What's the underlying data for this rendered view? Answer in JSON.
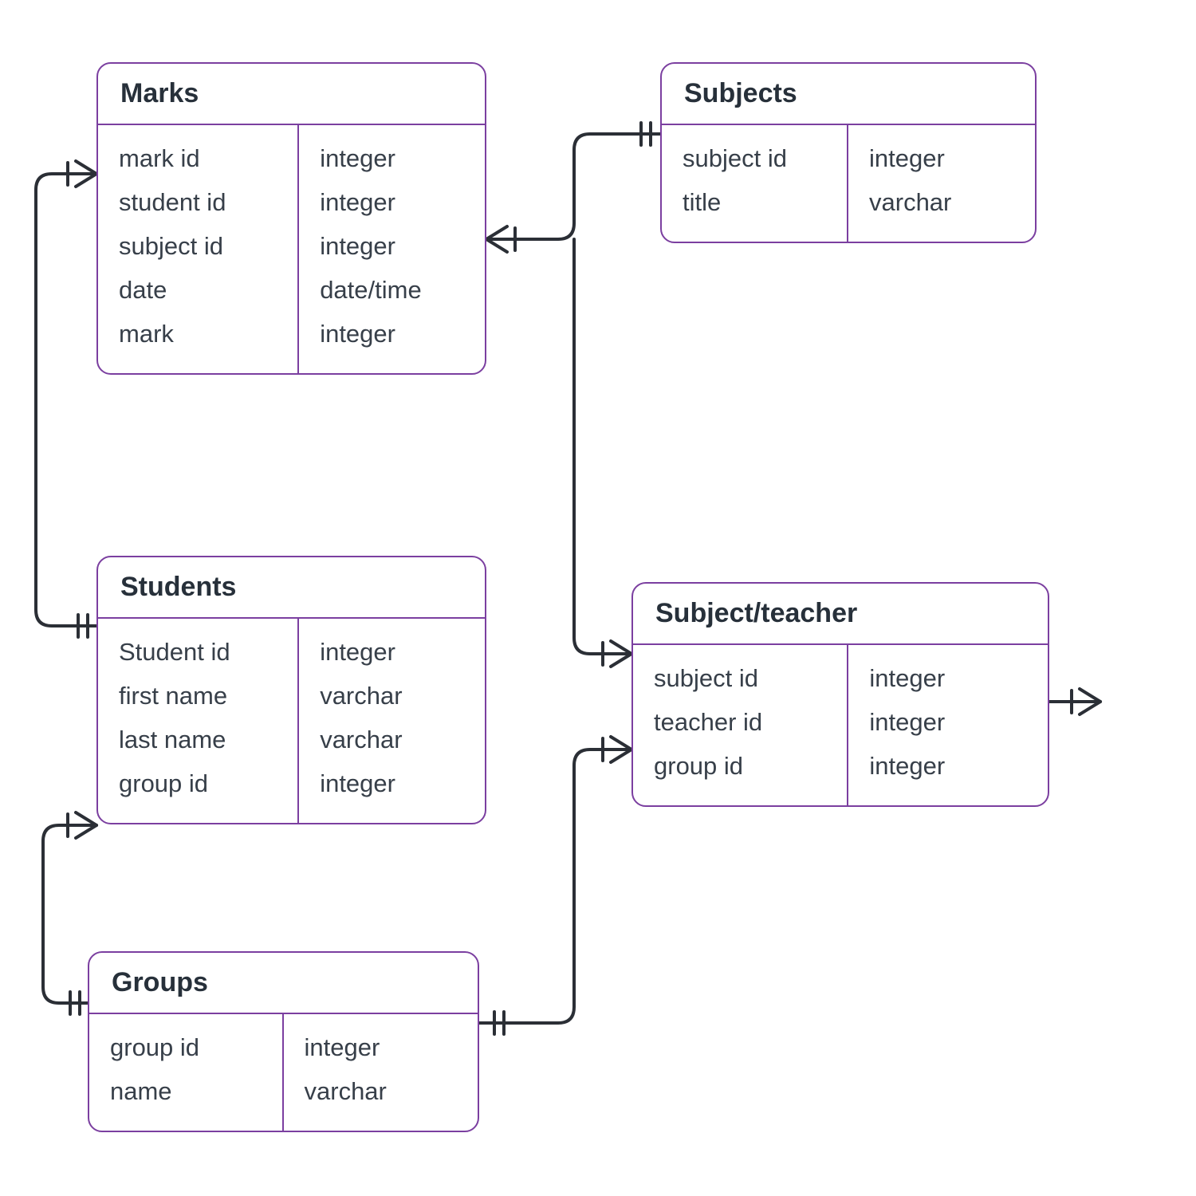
{
  "colors": {
    "border": "#7b3fa0",
    "text_title": "#27303a",
    "text_body": "#373f49",
    "wire": "#2b2f36"
  },
  "entities": {
    "marks": {
      "title": "Marks",
      "fields": [
        "mark id",
        "student id",
        "subject id",
        "date",
        "mark"
      ],
      "types": [
        "integer",
        "integer",
        "integer",
        "date/time",
        "integer"
      ]
    },
    "students": {
      "title": "Students",
      "fields": [
        "Student id",
        "first name",
        "last name",
        "group id"
      ],
      "types": [
        "integer",
        "varchar",
        "varchar",
        "integer"
      ]
    },
    "groups": {
      "title": "Groups",
      "fields": [
        "group id",
        "name"
      ],
      "types": [
        "integer",
        "varchar"
      ]
    },
    "subjects": {
      "title": "Subjects",
      "fields": [
        "subject id",
        "title"
      ],
      "types": [
        "integer",
        "varchar"
      ]
    },
    "subject_teacher": {
      "title": "Subject/teacher",
      "fields": [
        "subject id",
        "teacher id",
        "group id"
      ],
      "types": [
        "integer",
        "integer",
        "integer"
      ]
    }
  },
  "relationships": [
    {
      "from": "students",
      "to": "marks",
      "from_card": "one",
      "to_card": "many"
    },
    {
      "from": "groups",
      "to": "students",
      "from_card": "one",
      "to_card": "many"
    },
    {
      "from": "subjects",
      "to": "marks",
      "from_card": "one",
      "to_card": "many"
    },
    {
      "from": "subjects",
      "to": "subject_teacher",
      "from_card": "one",
      "to_card": "many"
    },
    {
      "from": "groups",
      "to": "subject_teacher",
      "from_card": "one",
      "to_card": "many"
    },
    {
      "from": "subject_teacher",
      "to": "external_right",
      "from_card": "one",
      "to_card": "many"
    }
  ]
}
